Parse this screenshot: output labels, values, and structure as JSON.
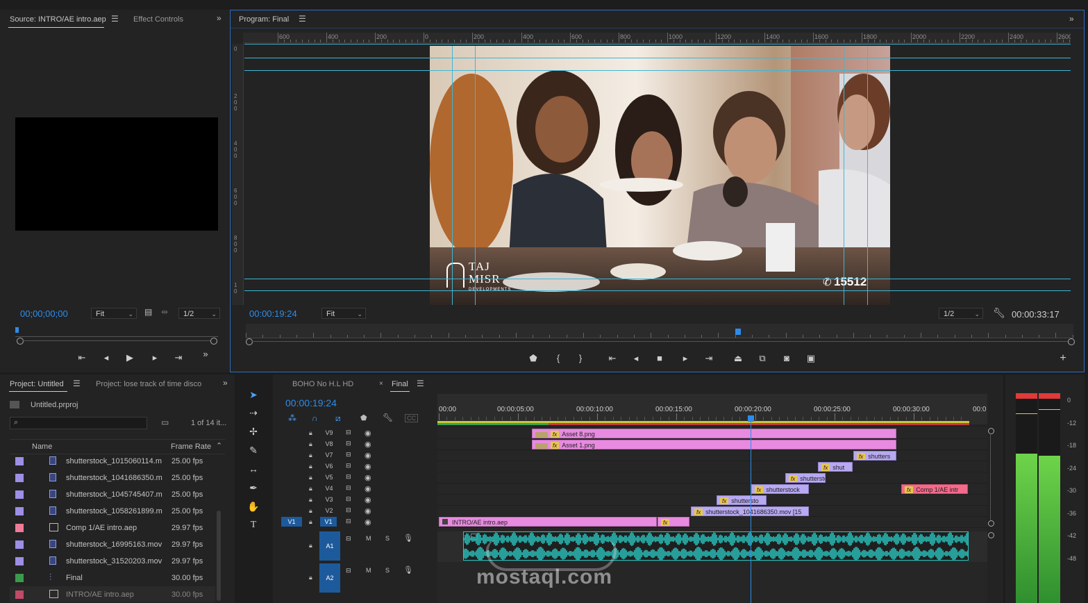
{
  "source_panel": {
    "tab_active": "Source: INTRO/AE intro.aep",
    "tab_effect_controls": "Effect Controls",
    "timecode": "00;00;00;00",
    "zoom": "Fit",
    "resolution": "1/2"
  },
  "program_panel": {
    "title": "Program: Final",
    "timecode_current": "00:00:19:24",
    "zoom": "Fit",
    "resolution": "1/2",
    "duration": "00:00:33:17",
    "ruler_labels": [
      "600",
      "400",
      "200",
      "0",
      "200",
      "400",
      "600",
      "800",
      "1000",
      "1200",
      "1400",
      "1600",
      "1800",
      "2000",
      "2200",
      "2400",
      "2600"
    ],
    "ruler_v_labels": [
      "0",
      "2\n0\n0",
      "4\n0\n0",
      "6\n0\n0",
      "8\n0\n0",
      "1\n0"
    ],
    "video_overlay": {
      "logo_line1": "TAJ",
      "logo_line2": "MISR",
      "logo_sub": "DEVELOPMENTS",
      "phone": "15512"
    },
    "playhead_fraction": 0.595
  },
  "project_panel": {
    "tab_active": "Project: Untitled",
    "tab_other": "Project:  lose track of time disco",
    "file": "Untitled.prproj",
    "count": "1 of 14 it...",
    "col_name": "Name",
    "col_rate": "Frame Rate",
    "items": [
      {
        "name": "shutterstock_1015060114.m",
        "rate": "25.00 fps",
        "color": "#9d8ee6",
        "kind": "clip-icon"
      },
      {
        "name": "shutterstock_1041686350.m",
        "rate": "25.00 fps",
        "color": "#9d8ee6",
        "kind": "clip-icon"
      },
      {
        "name": "shutterstock_1045745407.m",
        "rate": "25.00 fps",
        "color": "#9d8ee6",
        "kind": "clip-icon"
      },
      {
        "name": "shutterstock_1058261899.m",
        "rate": "25.00 fps",
        "color": "#9d8ee6",
        "kind": "clip-icon"
      },
      {
        "name": "Comp 1/AE intro.aep",
        "rate": "29.97 fps",
        "color": "#f07a98",
        "kind": "comp-icon"
      },
      {
        "name": "shutterstock_16995163.mov",
        "rate": "29.97 fps",
        "color": "#9d8ee6",
        "kind": "clip-icon"
      },
      {
        "name": "shutterstock_31520203.mov",
        "rate": "29.97 fps",
        "color": "#9d8ee6",
        "kind": "clip-icon"
      },
      {
        "name": "Final",
        "rate": "30.00 fps",
        "color": "#3c9a4c",
        "kind": "sequence-icon"
      },
      {
        "name": "INTRO/AE intro.aep",
        "rate": "30.00 fps",
        "color": "#c04a68",
        "kind": "comp-icon"
      }
    ]
  },
  "timeline": {
    "tab_other": "BOHO No H.L HD",
    "tab_active": "Final",
    "timecode": "00:00:19:24",
    "ruler_labels": [
      "00:00",
      "00:00:05:00",
      "00:00:10:00",
      "00:00:15:00",
      "00:00:20:00",
      "00:00:25:00",
      "00:00:30:00",
      "00:0"
    ],
    "video_tracks": [
      "V9",
      "V8",
      "V7",
      "V6",
      "V5",
      "V4",
      "V3",
      "V2",
      "V1"
    ],
    "source_patch": "V1",
    "audio_tracks": [
      "A1",
      "A2"
    ],
    "audio_buttons": {
      "mute": "M",
      "solo": "S"
    },
    "clips": [
      {
        "label": "Asset 8.png",
        "track": "V9",
        "color": "pink"
      },
      {
        "label": "Asset 1.png",
        "track": "V8",
        "color": "pink"
      },
      {
        "label": "shutters",
        "track": "V7",
        "color": "violet"
      },
      {
        "label": "shut",
        "track": "V6",
        "color": "violet"
      },
      {
        "label": "shuttersto",
        "track": "V5",
        "color": "violet"
      },
      {
        "label": "shutterstock",
        "track": "V4",
        "color": "violet"
      },
      {
        "label": "Comp 1/AE intr",
        "track": "V4",
        "color": "red"
      },
      {
        "label": "shuttersto",
        "track": "V3",
        "color": "violet"
      },
      {
        "label": "shutterstock_1041686350.mov [15",
        "track": "V2",
        "color": "violet"
      },
      {
        "label": "INTRO/AE intro.aep",
        "track": "V1",
        "color": "pink"
      }
    ],
    "fx_badge": "fx"
  },
  "meters": {
    "scale": [
      "0",
      "-12",
      "-18",
      "-24",
      "-30",
      "-36",
      "-42",
      "-48"
    ],
    "level_left": 0.77,
    "level_right": 0.76
  },
  "watermark": {
    "text": "mostaql.com"
  },
  "colors": {
    "accent": "#2d8ceb",
    "guide": "#3fb6d6",
    "audio": "#2ac9c3"
  }
}
